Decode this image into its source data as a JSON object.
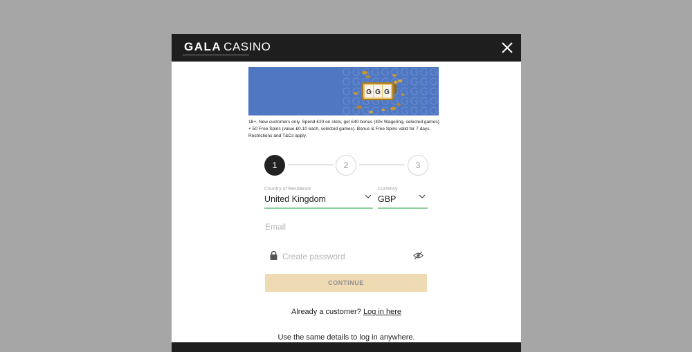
{
  "header": {
    "brand_gala": "GALA",
    "brand_casino": "CASINO"
  },
  "promo": {
    "terms": "18+. New customers only. Spend £20 on slots, get £40 bonus (40x Wagering, selected games) + 50 Free Spins (value £0.10 each, selected games). Bonus & Free Spins valid for 7 days. Restrictions and T&Cs apply.",
    "reel_symbols": [
      "G",
      "G",
      "G"
    ]
  },
  "stepper": {
    "steps": [
      "1",
      "2",
      "3"
    ],
    "current": 1
  },
  "form": {
    "country_label": "Country of Residence",
    "country_value": "United Kingdom",
    "currency_label": "Currency",
    "currency_value": "GBP",
    "email_placeholder": "Email",
    "password_placeholder": "Create password",
    "continue_label": "CONTINUE"
  },
  "footer": {
    "already_text": "Already a customer?",
    "login_link": "Log in here",
    "same_details": "Use the same details to log in anywhere."
  },
  "colors": {
    "overlay": "#a6a6a6",
    "header_bg": "#1e1e1e",
    "banner_bg": "#4f77c2",
    "underline_green": "#8fd19e",
    "button_bg": "#efdbb3"
  }
}
